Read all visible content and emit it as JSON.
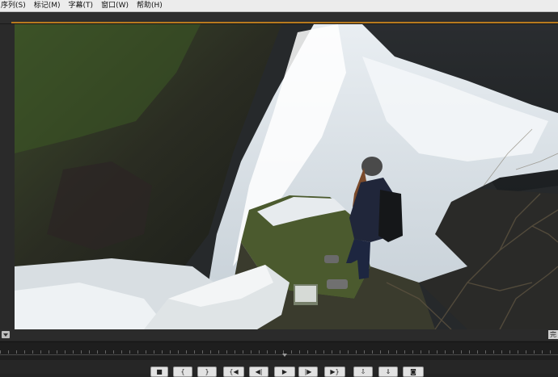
{
  "menu": {
    "items": [
      {
        "label": "序列(S)"
      },
      {
        "label": "标记(M)"
      },
      {
        "label": "字幕(T)"
      },
      {
        "label": "窗口(W)"
      },
      {
        "label": "帮助(H)"
      }
    ]
  },
  "viewer": {
    "scene": "waterfall-with-hiker",
    "fit_label": "完"
  },
  "transport": {
    "buttons": [
      {
        "name": "stop-button",
        "icon": "stop-icon",
        "glyph": "■"
      },
      {
        "name": "mark-in-button",
        "icon": "mark-in-icon",
        "glyph": "{"
      },
      {
        "name": "mark-out-button",
        "icon": "mark-out-icon",
        "glyph": "}"
      },
      {
        "name": "go-to-in-button",
        "icon": "go-to-in-icon",
        "glyph": "{◀"
      },
      {
        "name": "step-back-button",
        "icon": "step-back-icon",
        "glyph": "◀|"
      },
      {
        "name": "play-button",
        "icon": "play-icon",
        "glyph": "▶"
      },
      {
        "name": "step-forward-button",
        "icon": "step-forward-icon",
        "glyph": "|▶"
      },
      {
        "name": "go-to-out-button",
        "icon": "go-to-out-icon",
        "glyph": "▶}"
      },
      {
        "name": "insert-button",
        "icon": "insert-icon",
        "glyph": "⇩"
      },
      {
        "name": "overwrite-button",
        "icon": "overwrite-icon",
        "glyph": "⇓"
      },
      {
        "name": "export-frame-button",
        "icon": "camera-icon",
        "glyph": "◙"
      }
    ]
  },
  "colors": {
    "accent": "#b87a1e",
    "panel_bg": "#232323",
    "menu_bg": "#ececec"
  }
}
